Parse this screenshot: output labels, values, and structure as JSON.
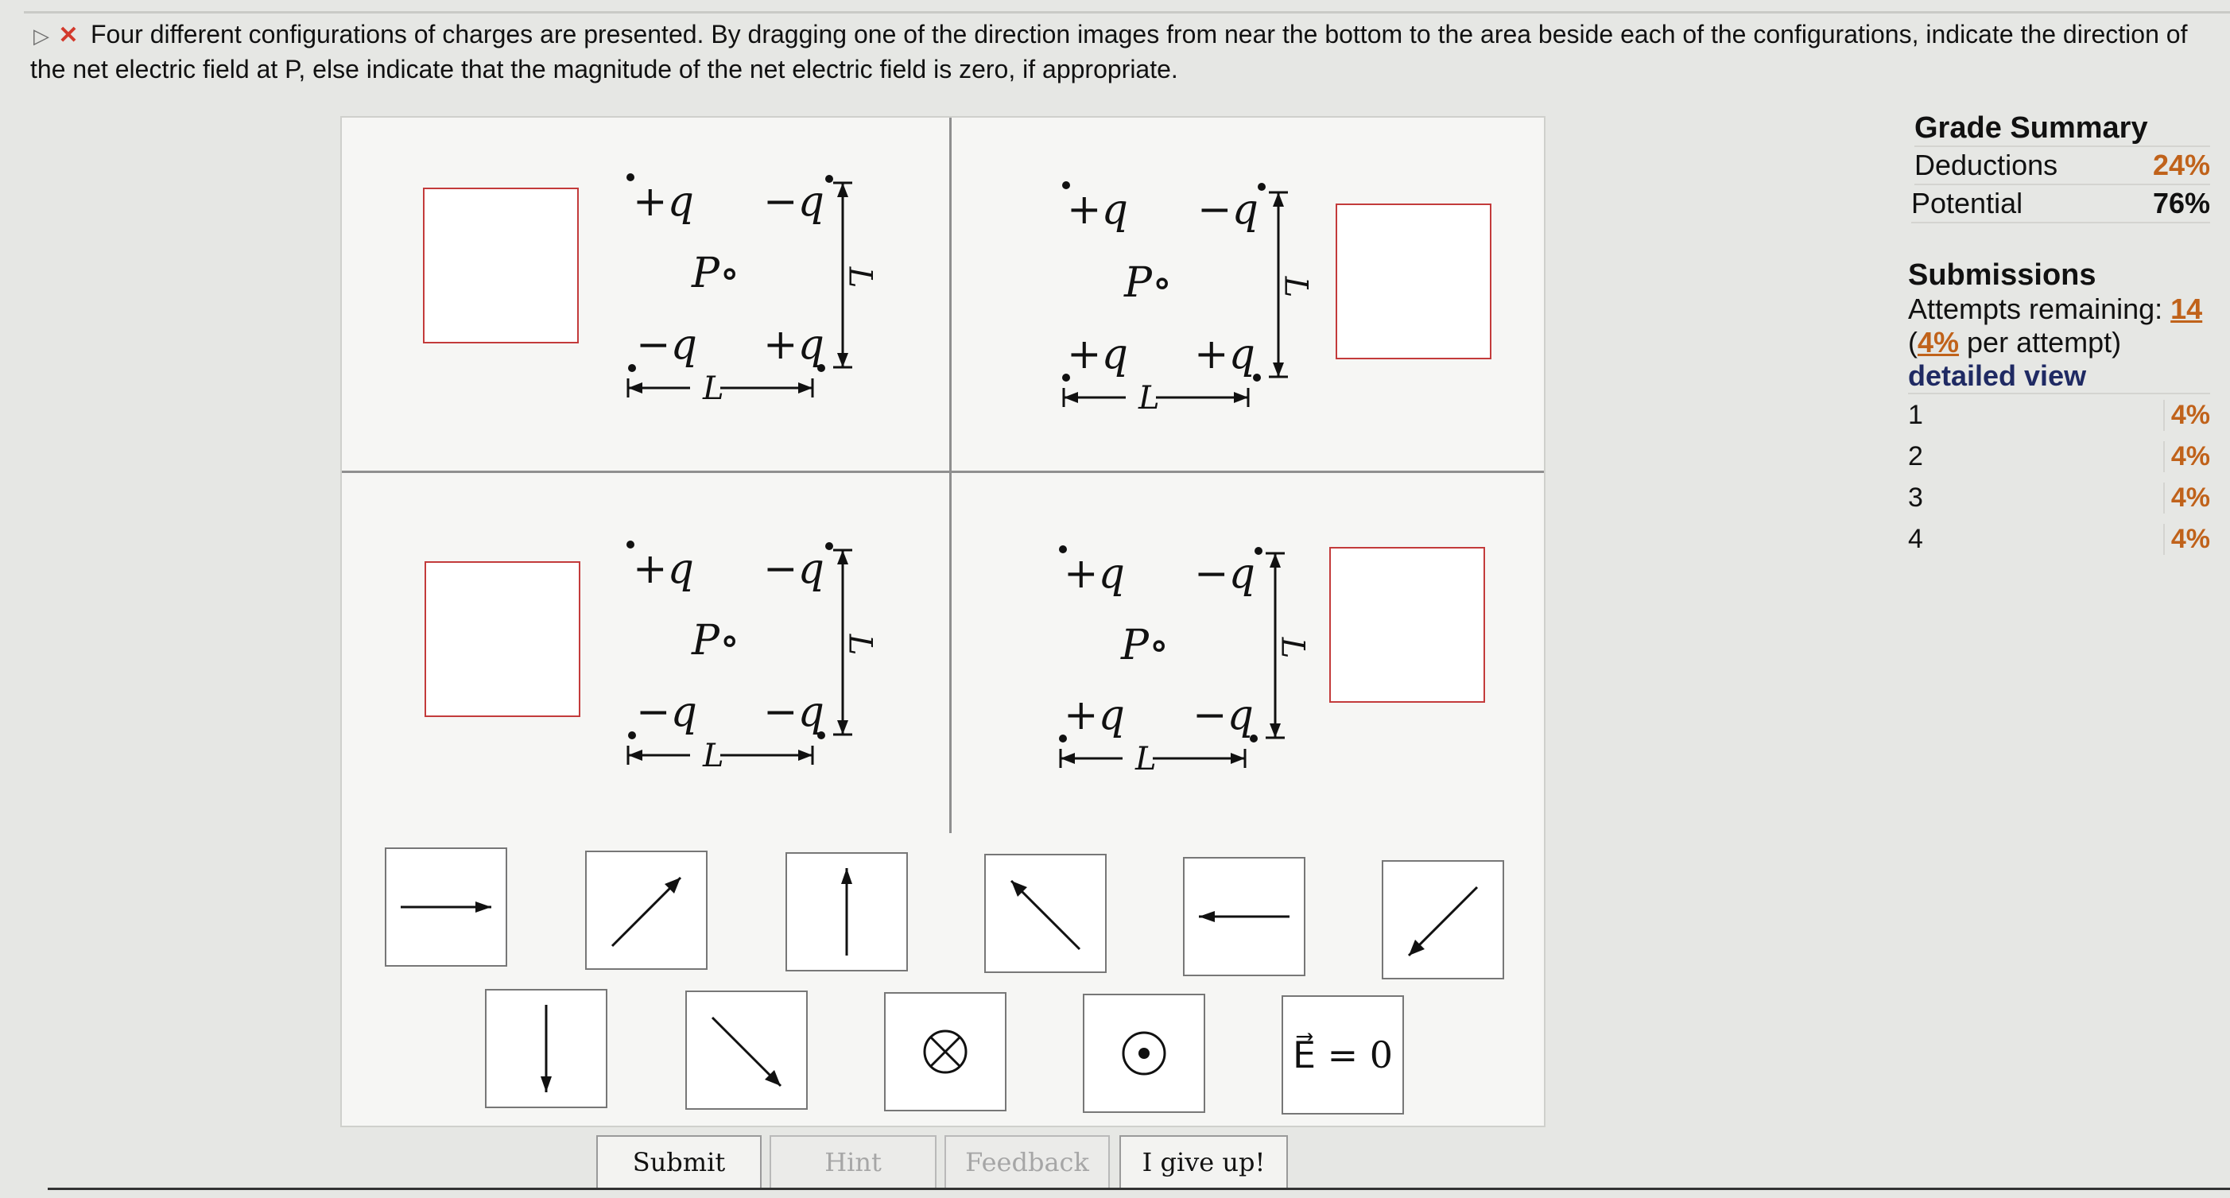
{
  "question": {
    "text": "Four different configurations of charges are presented. By dragging one of the direction images from near the bottom to the area beside each of the configurations, indicate the direction of the net electric field at P, else indicate that the magnitude of the net electric field is zero, if appropriate."
  },
  "configs": [
    {
      "tl": "+q",
      "tr": "−q",
      "bl": "−q",
      "br": "+q",
      "p": "P∘",
      "len": "L"
    },
    {
      "tl": "+q",
      "tr": "−q",
      "bl": "+q",
      "br": "+q",
      "p": "P∘",
      "len": "L"
    },
    {
      "tl": "+q",
      "tr": "−q",
      "bl": "−q",
      "br": "−q",
      "p": "P∘",
      "len": "L"
    },
    {
      "tl": "+q",
      "tr": "−q",
      "bl": "+q",
      "br": "−q",
      "p": "P∘",
      "len": "L"
    }
  ],
  "tiles": [
    {
      "icon": "arrow-right-icon"
    },
    {
      "icon": "arrow-up-right-icon"
    },
    {
      "icon": "arrow-up-icon"
    },
    {
      "icon": "arrow-up-left-icon"
    },
    {
      "icon": "arrow-left-icon"
    },
    {
      "icon": "arrow-down-left-icon"
    },
    {
      "icon": "arrow-down-icon"
    },
    {
      "icon": "arrow-down-right-icon"
    },
    {
      "icon": "into-page-icon"
    },
    {
      "icon": "out-of-page-icon"
    },
    {
      "label": "E⃗ = 0"
    }
  ],
  "buttons": {
    "submit": "Submit",
    "hint": "Hint",
    "feedback": "Feedback",
    "give_up": "I give up!"
  },
  "grade_summary": {
    "title": "Grade Summary",
    "deductions_label": "Deductions",
    "deductions_value": "24%",
    "potential_label": "Potential",
    "potential_value": "76%"
  },
  "submissions": {
    "title": "Submissions",
    "attempts_label": "Attempts remaining:",
    "attempts_value": "14",
    "per_attempt_value": "4%",
    "per_attempt_suffix": " per attempt)",
    "detailed_view": "detailed view",
    "rows": [
      {
        "n": "1",
        "p": "4%"
      },
      {
        "n": "2",
        "p": "4%"
      },
      {
        "n": "3",
        "p": "4%"
      },
      {
        "n": "4",
        "p": "4%"
      }
    ]
  },
  "colors": {
    "accent": "#c0621a",
    "drop_border": "#c33b3b",
    "link": "#1f2a63"
  }
}
